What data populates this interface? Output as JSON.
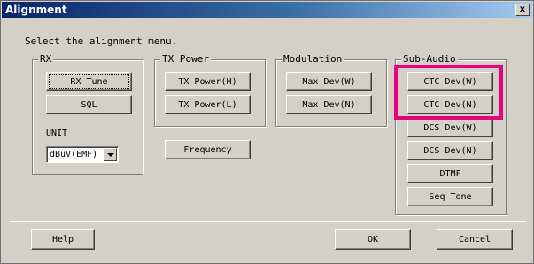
{
  "window": {
    "title": "Alignment",
    "close_label": "x"
  },
  "instruction": "Select the alignment menu.",
  "rx": {
    "group_label": "RX",
    "rx_tune": "RX Tune",
    "sql": "SQL",
    "unit_label": "UNIT",
    "unit_value": "dBuV(EMF)"
  },
  "tx_power": {
    "group_label": "TX Power",
    "high": "TX Power(H)",
    "low": "TX Power(L)"
  },
  "modulation": {
    "group_label": "Modulation",
    "max_dev_w": "Max Dev(W)",
    "max_dev_n": "Max Dev(N)"
  },
  "frequency": "Frequency",
  "sub_audio": {
    "group_label": "Sub-Audio",
    "ctc_dev_w": "CTC Dev(W)",
    "ctc_dev_n": "CTC Dev(N)",
    "dcs_dev_w": "DCS Dev(W)",
    "dcs_dev_n": "DCS Dev(N)",
    "dtmf": "DTMF",
    "seq_tone": "Seq Tone"
  },
  "footer": {
    "help": "Help",
    "ok": "OK",
    "cancel": "Cancel"
  },
  "colors": {
    "highlight": "#e6007e",
    "title_bar": "#0a246a",
    "face": "#d4d0c8"
  },
  "icons": {
    "close": "close-icon",
    "dropdown": "chevron-down-icon"
  }
}
